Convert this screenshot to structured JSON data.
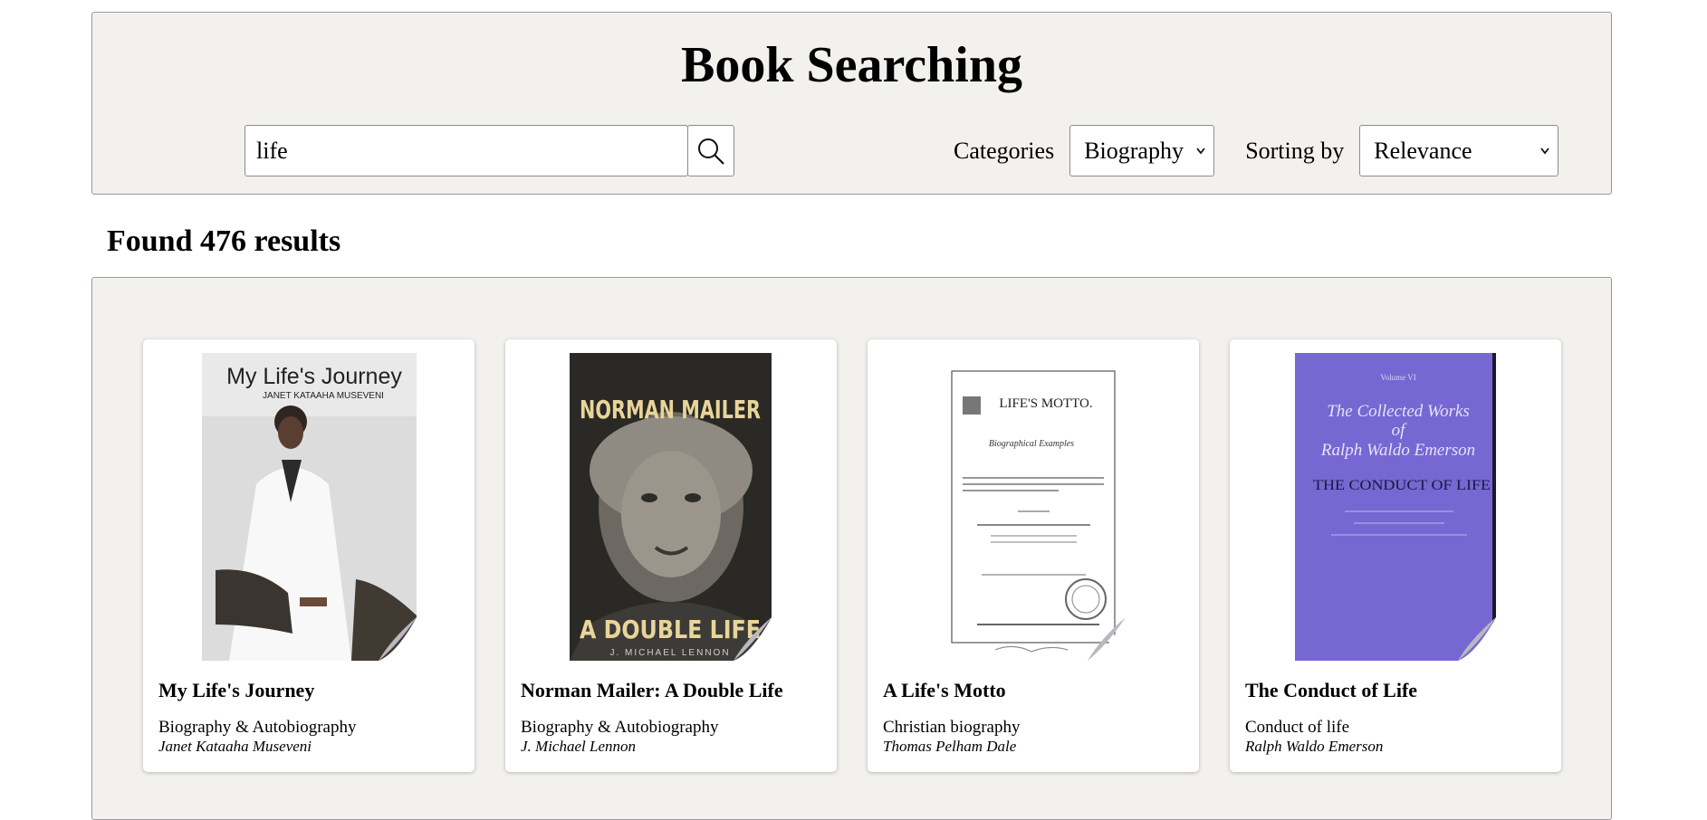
{
  "header": {
    "title": "Book Searching",
    "search": {
      "value": "life",
      "placeholder": ""
    },
    "categories_label": "Categories",
    "category_selected": "Biography",
    "sorting_label": "Sorting by",
    "sorting_selected": "Relevance"
  },
  "results": {
    "summary": "Found 476 results",
    "books": [
      {
        "title": "My Life's Journey",
        "category": "Biography & Autobiography",
        "author": "Janet Kataaha Museveni",
        "cover": {
          "title_text": "My Life's Journey",
          "author_text": "JANET KATAAHA MUSEVENI"
        }
      },
      {
        "title": "Norman Mailer: A Double Life",
        "category": "Biography & Autobiography",
        "author": "J. Michael Lennon",
        "cover": {
          "top_text": "NORMAN MAILER",
          "bottom_text": "A DOUBLE LIFE",
          "author_text": "J. MICHAEL LENNON"
        }
      },
      {
        "title": "A Life's Motto",
        "category": "Christian biography",
        "author": "Thomas Pelham Dale",
        "cover": {
          "title_text": "LIFE'S MOTTO.",
          "subtitle_text": "Biographical Examples"
        }
      },
      {
        "title": "The Conduct of Life",
        "category": "Conduct of life",
        "author": "Ralph Waldo Emerson",
        "cover": {
          "volume_text": "Volume VI",
          "series_line1": "The Collected Works",
          "series_line2": "of",
          "series_line3": "Ralph Waldo Emerson",
          "title_text": "THE CONDUCT OF LIFE"
        }
      }
    ]
  },
  "colors": {
    "panel_bg": "#f2f1ee",
    "emerson_cover": "#7667d2"
  }
}
